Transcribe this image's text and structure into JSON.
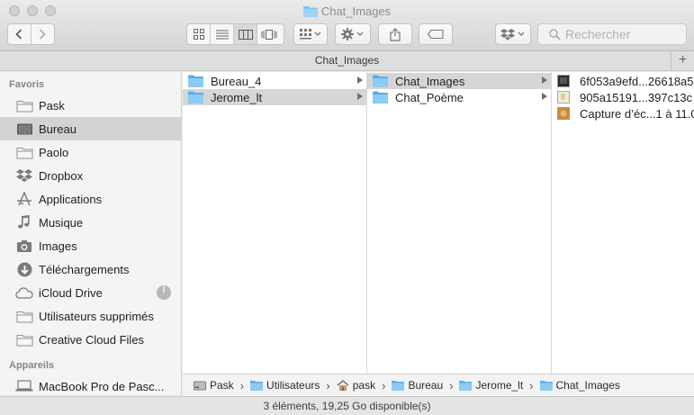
{
  "window": {
    "title": "Chat_Images"
  },
  "toolbar": {
    "search_placeholder": "Rechercher"
  },
  "tabbar": {
    "title": "Chat_Images",
    "plus": "+"
  },
  "sidebar": {
    "favorites_header": "Favoris",
    "favorites": [
      {
        "label": "Pask",
        "icon": "folder-icon"
      },
      {
        "label": "Bureau",
        "icon": "desktop-icon"
      },
      {
        "label": "Paolo",
        "icon": "folder-icon"
      },
      {
        "label": "Dropbox",
        "icon": "dropbox-icon"
      },
      {
        "label": "Applications",
        "icon": "applications-icon"
      },
      {
        "label": "Musique",
        "icon": "music-icon"
      },
      {
        "label": "Images",
        "icon": "camera-icon"
      },
      {
        "label": "Téléchargements",
        "icon": "download-icon"
      },
      {
        "label": "iCloud Drive",
        "icon": "cloud-icon"
      },
      {
        "label": "Utilisateurs supprimés",
        "icon": "folder-icon"
      },
      {
        "label": "Creative Cloud Files",
        "icon": "folder-icon"
      }
    ],
    "devices_header": "Appareils",
    "devices": [
      {
        "label": "MacBook Pro de Pasc...",
        "icon": "laptop-icon"
      }
    ]
  },
  "columns": {
    "col1": [
      {
        "label": "Bureau_4"
      },
      {
        "label": "Jerome_lt"
      }
    ],
    "col2": [
      {
        "label": "Chat_Images"
      },
      {
        "label": "Chat_Poème"
      }
    ],
    "col3": [
      {
        "label": "6f053a9efd...26618a5"
      },
      {
        "label": "905a15191...397c13c"
      },
      {
        "label": "Capture d’éc...1 à 11.0"
      }
    ]
  },
  "pathbar": [
    {
      "label": "Pask",
      "icon": "disk-icon"
    },
    {
      "label": "Utilisateurs",
      "icon": "folder-icon"
    },
    {
      "label": "pask",
      "icon": "home-icon"
    },
    {
      "label": "Bureau",
      "icon": "folder-icon"
    },
    {
      "label": "Jerome_lt",
      "icon": "folder-icon"
    },
    {
      "label": "Chat_Images",
      "icon": "folder-icon"
    }
  ],
  "status": {
    "text": "3 éléments, 19,25 Go disponible(s)"
  },
  "colors": {
    "folder_blue": "#6cb6ec",
    "selection_gray": "#d6d6d6"
  }
}
